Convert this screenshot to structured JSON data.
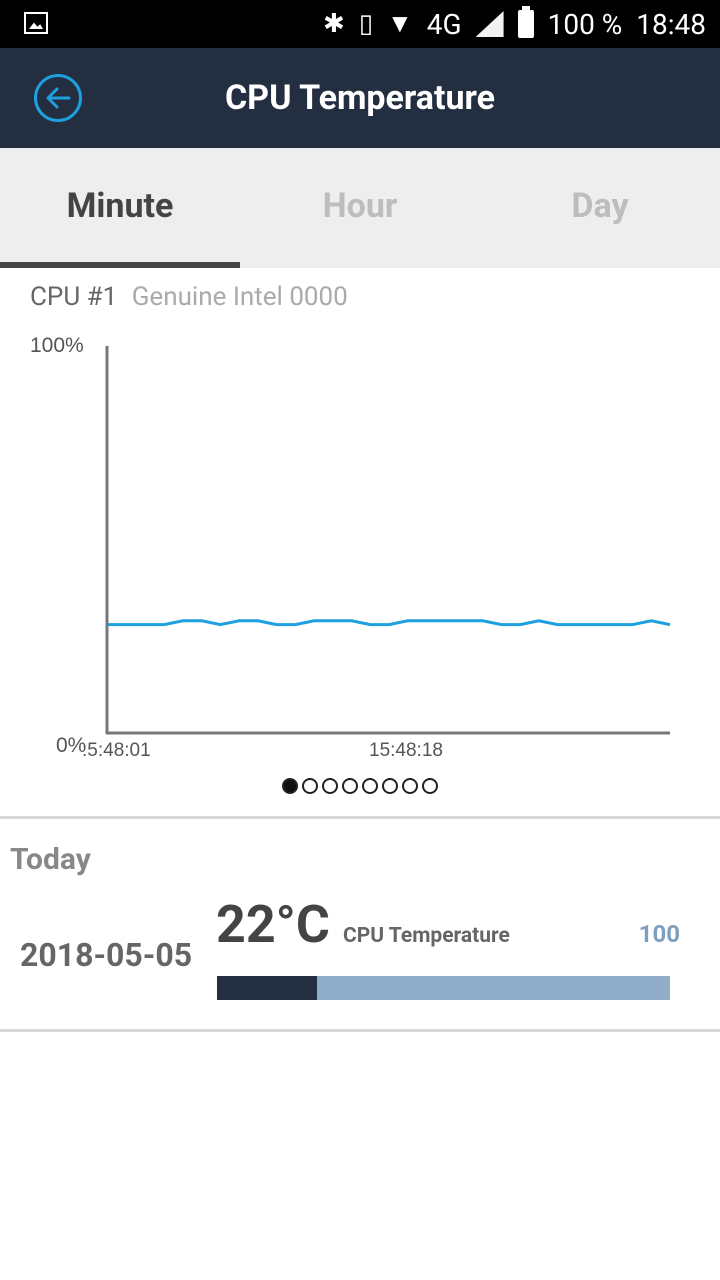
{
  "status_bar": {
    "battery": "100 %",
    "time": "18:48",
    "network": "4G"
  },
  "app_bar": {
    "title": "CPU Temperature",
    "back_icon": "back-arrow-icon"
  },
  "tabs": [
    {
      "label": "Minute",
      "active": true
    },
    {
      "label": "Hour",
      "active": false
    },
    {
      "label": "Day",
      "active": false
    }
  ],
  "cpu": {
    "name": "CPU #1",
    "model": "Genuine Intel 0000"
  },
  "chart_data": {
    "type": "line",
    "y_top_label": "100%",
    "y_bottom_label": "0%",
    "ylim": [
      0,
      100
    ],
    "x_tick_labels": [
      ":5:48:01",
      "15:48:18"
    ],
    "values": [
      28,
      28,
      28,
      28,
      29,
      29,
      28,
      29,
      29,
      28,
      28,
      29,
      29,
      29,
      28,
      28,
      29,
      29,
      29,
      29,
      29,
      28,
      28,
      29,
      28,
      28,
      28,
      28,
      28,
      29,
      28
    ],
    "color": "#1ea0e0"
  },
  "pager": {
    "count": 8,
    "active": 0
  },
  "today": {
    "heading": "Today",
    "date": "2018-05-05",
    "temperature": "22°C",
    "label": "CPU Temperature",
    "max_label": "100",
    "level_fraction": 0.22
  }
}
